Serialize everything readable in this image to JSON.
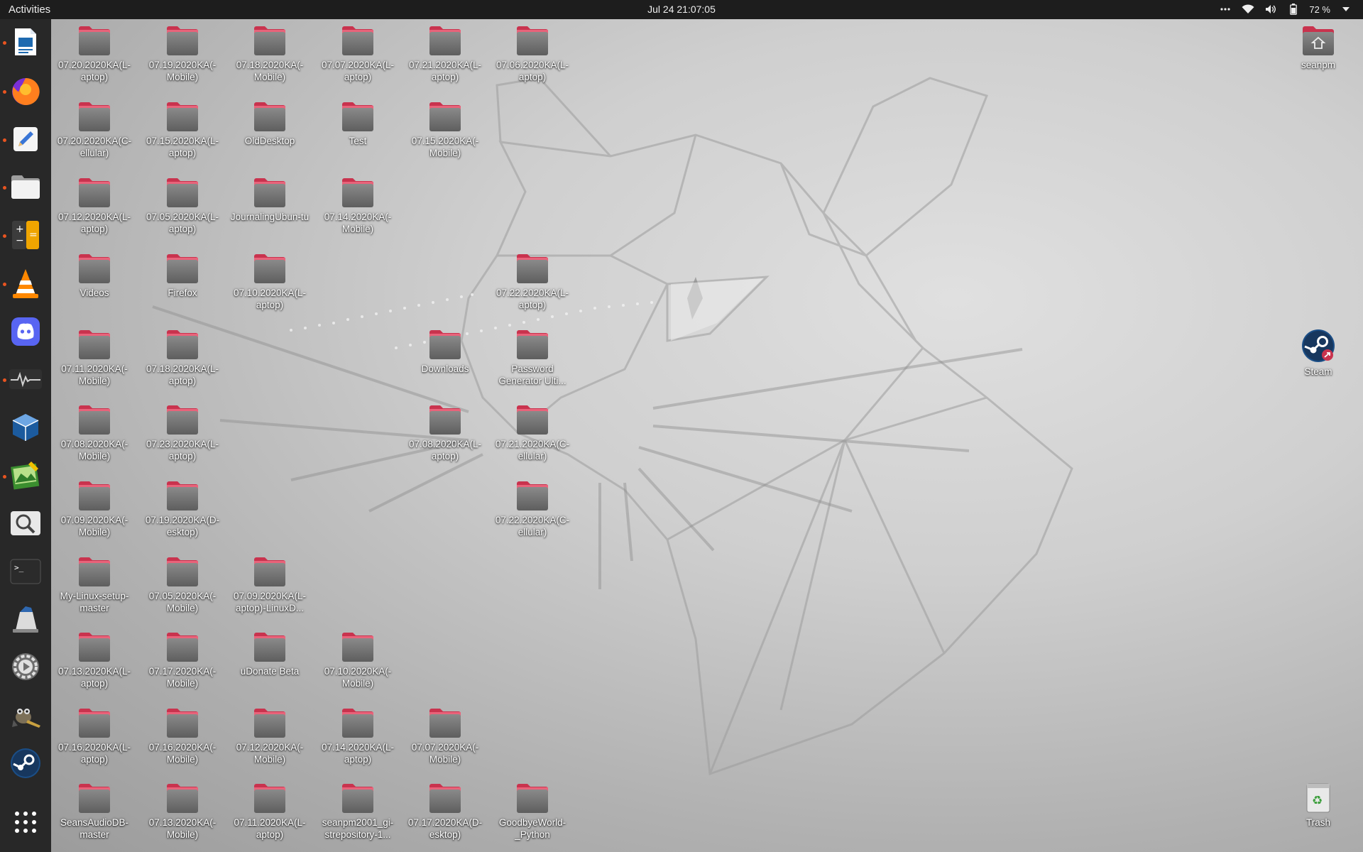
{
  "topbar": {
    "activities_label": "Activities",
    "clock": "Jul 24  21:07:05",
    "overflow_icon": "more-icon",
    "battery_label": "72 %"
  },
  "dock": {
    "apps": [
      {
        "name": "LibreOffice Writer",
        "icon": "writer-icon",
        "running": true
      },
      {
        "name": "Firefox",
        "icon": "firefox-icon",
        "running": true
      },
      {
        "name": "Text Editor",
        "icon": "text-editor-icon",
        "running": true
      },
      {
        "name": "Files",
        "icon": "files-icon",
        "running": true
      },
      {
        "name": "Calculator",
        "icon": "calculator-icon",
        "running": true
      },
      {
        "name": "VLC",
        "icon": "vlc-icon",
        "running": true
      },
      {
        "name": "Discord",
        "icon": "discord-icon",
        "running": false
      },
      {
        "name": "System Monitor",
        "icon": "system-monitor-icon",
        "running": true
      },
      {
        "name": "VirtualBox",
        "icon": "virtualbox-icon",
        "running": false
      },
      {
        "name": "Image Viewer",
        "icon": "image-viewer-icon",
        "running": true
      },
      {
        "name": "Search",
        "icon": "magnifier-icon",
        "running": false
      },
      {
        "name": "Terminal",
        "icon": "terminal-icon",
        "running": false
      },
      {
        "name": "Screenshot",
        "icon": "screenshot-icon",
        "running": false
      },
      {
        "name": "Settings",
        "icon": "settings-icon",
        "running": false
      },
      {
        "name": "GIMP",
        "icon": "gimp-icon",
        "running": false
      },
      {
        "name": "Steam",
        "icon": "steam-icon",
        "running": false
      },
      {
        "name": "Show Applications",
        "icon": "app-grid-icon",
        "running": false
      }
    ]
  },
  "desktop": {
    "items": [
      {
        "label": "07.20.2020KA(L-aptop)",
        "type": "folder"
      },
      {
        "label": "07.19.2020KA(-Mobile)",
        "type": "folder"
      },
      {
        "label": "07.18.2020KA(-Mobile)",
        "type": "folder"
      },
      {
        "label": "07.07.2020KA(L-aptop)",
        "type": "folder"
      },
      {
        "label": "07.21.2020KA(L-aptop)",
        "type": "folder"
      },
      {
        "label": "07.06.2020KA(L-aptop)",
        "type": "folder"
      },
      {
        "label": "07.20.2020KA(C-ellular)",
        "type": "folder"
      },
      {
        "label": "07.15.2020KA(L-aptop)",
        "type": "folder"
      },
      {
        "label": "OldDesktop",
        "type": "folder"
      },
      {
        "label": "Test",
        "type": "folder"
      },
      {
        "label": "07.15.2020KA(-Mobile)",
        "type": "folder"
      },
      {
        "label": "07.12.2020KA(L-aptop)",
        "type": "folder"
      },
      {
        "label": "07.05.2020KA(L-aptop)",
        "type": "folder"
      },
      {
        "label": "JournalingUbun-tu",
        "type": "folder"
      },
      {
        "label": "07.14.2020KA(-Mobile)",
        "type": "folder"
      },
      {
        "label": "Videos",
        "type": "folder"
      },
      {
        "label": "Firefox",
        "type": "folder"
      },
      {
        "label": "07.10.2020KA(L-aptop)",
        "type": "folder"
      },
      {
        "label": "07.22.2020KA(L-aptop)",
        "type": "folder"
      },
      {
        "label": "07.11.2020KA(-Mobile)",
        "type": "folder"
      },
      {
        "label": "07.18.2020KA(L-aptop)",
        "type": "folder"
      },
      {
        "label": "Downloads",
        "type": "folder"
      },
      {
        "label": "Password Generator Ulti...",
        "type": "folder"
      },
      {
        "label": "07.08.2020KA(-Mobile)",
        "type": "folder"
      },
      {
        "label": "07.23.2020KA(L-aptop)",
        "type": "folder"
      },
      {
        "label": "07.08.2020KA(L-aptop)",
        "type": "folder"
      },
      {
        "label": "07.21.2020KA(C-ellular)",
        "type": "folder"
      },
      {
        "label": "07.09.2020KA(-Mobile)",
        "type": "folder"
      },
      {
        "label": "07.19.2020KA(D-esktop)",
        "type": "folder"
      },
      {
        "label": "07.22.2020KA(C-ellular)",
        "type": "folder"
      },
      {
        "label": "My-Linux-setup-master",
        "type": "folder"
      },
      {
        "label": "07.05.2020KA(-Mobile)",
        "type": "folder"
      },
      {
        "label": "07.09.2020KA(L-aptop)-LinuxD...",
        "type": "folder"
      },
      {
        "label": "07.13.2020KA(L-aptop)",
        "type": "folder"
      },
      {
        "label": "07.17.2020KA(-Mobile)",
        "type": "folder"
      },
      {
        "label": "uDonate Beta",
        "type": "folder"
      },
      {
        "label": "07.10.2020KA(-Mobile)",
        "type": "folder"
      },
      {
        "label": "07.16.2020KA(L-aptop)",
        "type": "folder"
      },
      {
        "label": "07.16.2020KA(-Mobile)",
        "type": "folder"
      },
      {
        "label": "07.12.2020KA(-Mobile)",
        "type": "folder"
      },
      {
        "label": "07.14.2020KA(L-aptop)",
        "type": "folder"
      },
      {
        "label": "07.07.2020KA(-Mobile)",
        "type": "folder"
      },
      {
        "label": "SeansAudioDB-master",
        "type": "folder"
      },
      {
        "label": "07.13.2020KA(-Mobile)",
        "type": "folder"
      },
      {
        "label": "07.11.2020KA(L-aptop)",
        "type": "folder"
      },
      {
        "label": "seanpm2001_gi-strepository-1...",
        "type": "folder"
      },
      {
        "label": "07.17.2020KA(D-esktop)",
        "type": "folder"
      },
      {
        "label": "GoodbyeWorld-_Python",
        "type": "folder"
      },
      {
        "label": "seanpm",
        "type": "home"
      },
      {
        "label": "Steam",
        "type": "launcher"
      },
      {
        "label": "Trash",
        "type": "trash"
      }
    ]
  }
}
